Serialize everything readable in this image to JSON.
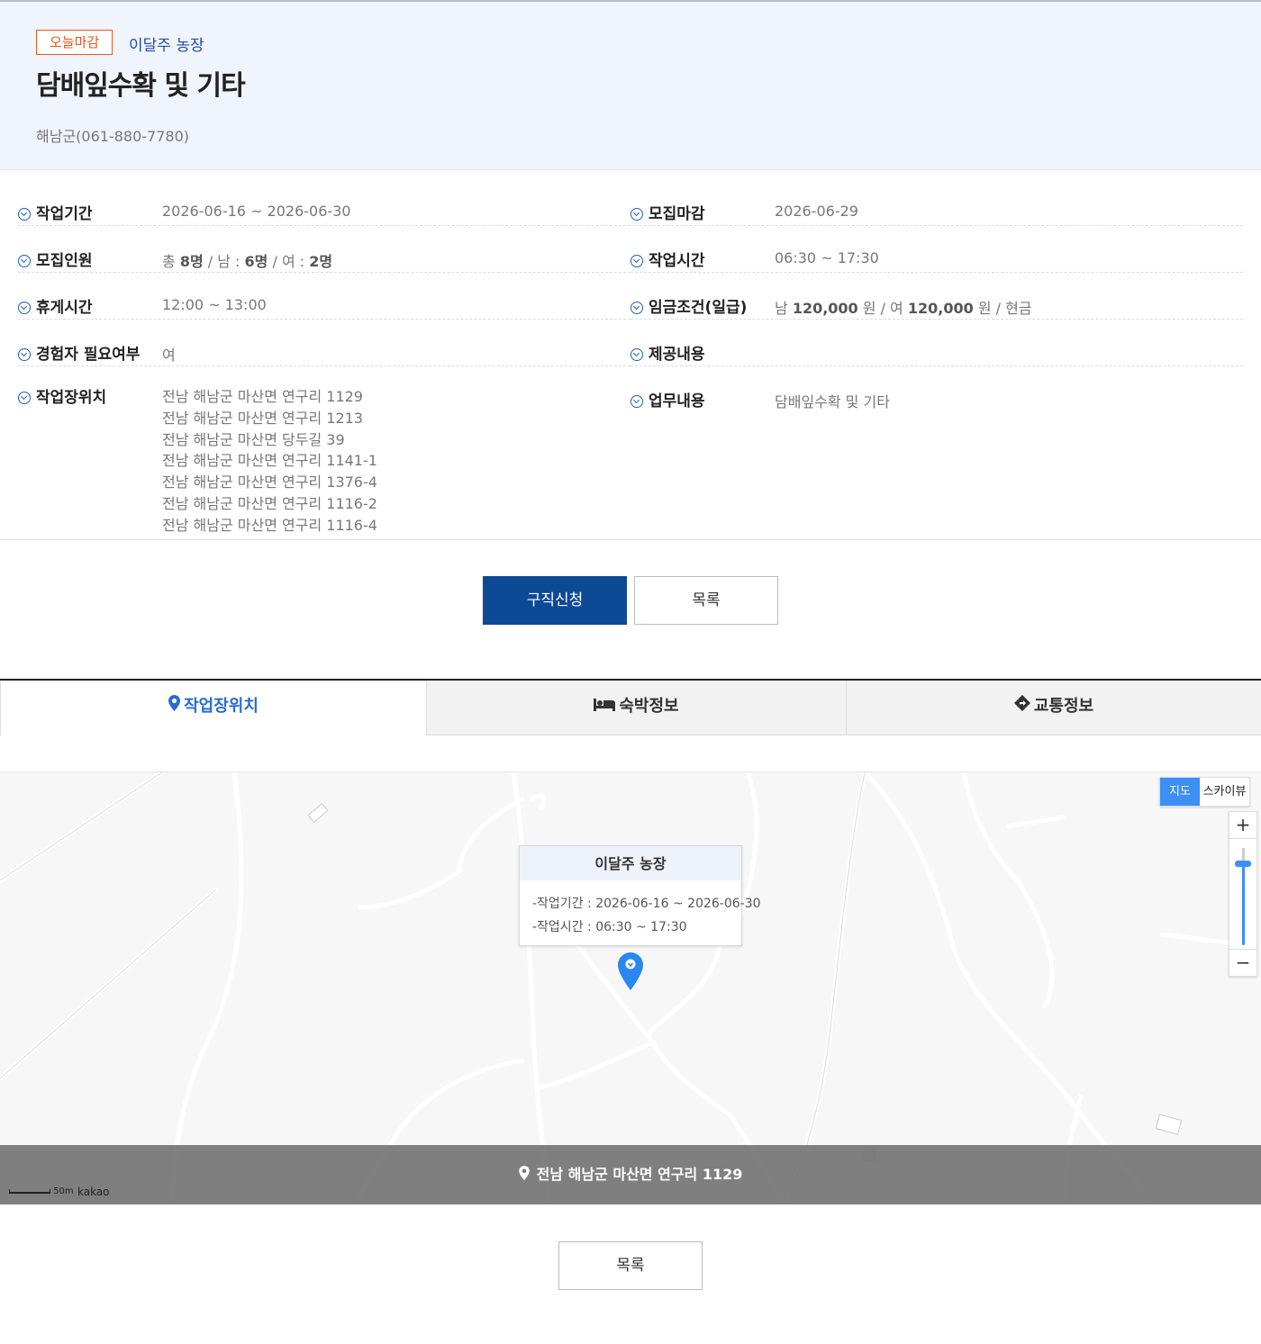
{
  "header": {
    "badge": "오늘마감",
    "farm": "이달주 농장",
    "title": "담배잎수확 및 기타",
    "contact": "해남군(061-880-7780)"
  },
  "info": {
    "work_period": {
      "label": "작업기간",
      "value": "2026-06-16 ~ 2026-06-30"
    },
    "deadline": {
      "label": "모집마감",
      "value": "2026-06-29"
    },
    "headcount": {
      "label": "모집인원",
      "total_prefix": "총 ",
      "total": "8명",
      "male_prefix": " / 남 : ",
      "male": "6명",
      "female_prefix": " / 여 : ",
      "female": "2명"
    },
    "work_hours": {
      "label": "작업시간",
      "value": "06:30 ~ 17:30"
    },
    "break_time": {
      "label": "휴게시간",
      "value": "12:00 ~ 13:00"
    },
    "wage": {
      "label": "임금조건(일급)",
      "male_prefix": "남 ",
      "male": "120,000",
      "mid": " 원 / 여 ",
      "female": "120,000",
      "suffix": " 원 / 현금"
    },
    "experience": {
      "label": "경험자 필요여부",
      "value": "여"
    },
    "provided": {
      "label": "제공내용",
      "value": ""
    },
    "location": {
      "label": "작업장위치",
      "values": [
        "전남 해남군 마산면 연구리 1129",
        "전남 해남군 마산면 연구리 1213",
        "전남 해남군 마산면 당두길 39",
        "전남 해남군 마산면 연구리 1141-1",
        "전남 해남군 마산면 연구리 1376-4",
        "전남 해남군 마산면 연구리 1116-2",
        "전남 해남군 마산면 연구리 1116-4"
      ]
    },
    "duties": {
      "label": "업무내용",
      "value": "담배잎수확 및 기타"
    }
  },
  "buttons": {
    "apply": "구직신청",
    "list": "목록",
    "list_bottom": "목록"
  },
  "tabs": [
    {
      "label": "작업장위치",
      "icon": "map-pin-icon",
      "active": true
    },
    {
      "label": "숙박정보",
      "icon": "bed-icon",
      "active": false
    },
    {
      "label": "교통정보",
      "icon": "direction-sign-icon",
      "active": false
    }
  ],
  "map": {
    "type_map": "지도",
    "type_sky": "스카이뷰",
    "zoom_in": "+",
    "zoom_out": "−",
    "infowindow": {
      "title": "이달주 농장",
      "period": "-작업기간 : 2026-06-16 ~ 2026-06-30",
      "hours": "-작업시간 : 06:30 ~ 17:30"
    },
    "address": "전남 해남군 마산면 연구리 1129",
    "scale": "50m",
    "brand": "kakao"
  },
  "colors": {
    "accent": "#0d4a96",
    "badge": "#e2581f",
    "tab_active": "#2a6bd0",
    "map_ui": "#3b8ff5"
  }
}
